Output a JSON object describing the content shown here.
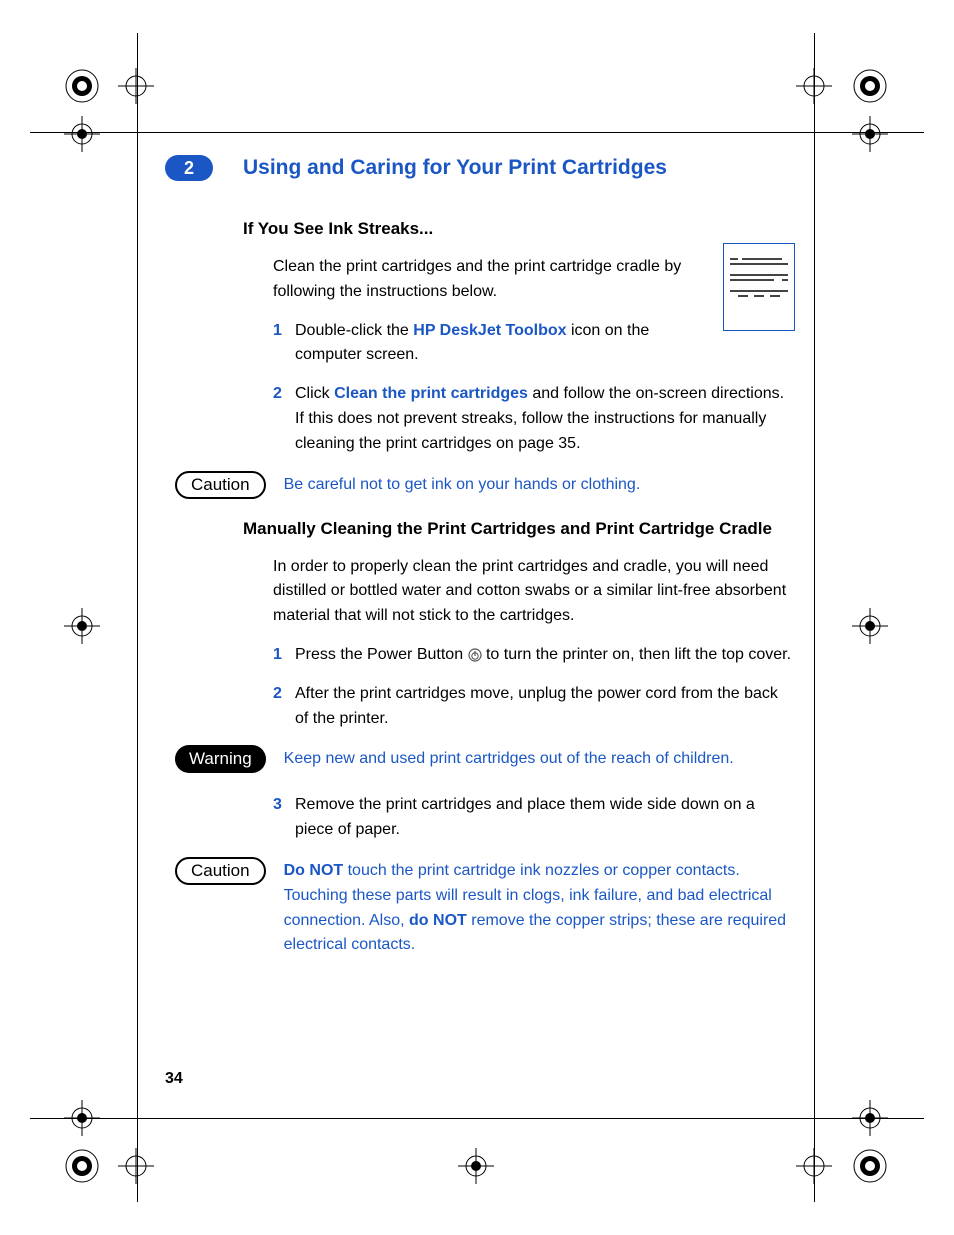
{
  "chapter": {
    "number": "2",
    "title": "Using and Caring for Your Print Cartridges"
  },
  "section1": {
    "title": "If You See Ink Streaks...",
    "intro": "Clean the print cartridges and the print cartridge cradle by following the instructions below.",
    "step1_a": "Double-click the ",
    "step1_link": "HP DeskJet Toolbox",
    "step1_b": " icon on the computer screen.",
    "step2_a": "Click ",
    "step2_link": "Clean the print cartridges",
    "step2_b": " and follow the on-screen directions. If this does not prevent streaks, follow the instructions for manually cleaning the print cartridges on page 35."
  },
  "caution1": {
    "label": "Caution",
    "text": "Be careful not to get ink on your hands or clothing."
  },
  "section2": {
    "title": "Manually Cleaning the Print Cartridges and Print Cartridge Cradle",
    "intro": "In order to properly clean the print cartridges and cradle, you will need distilled or bottled water and cotton swabs or a similar lint-free absorbent material that will not stick to the cartridges.",
    "step1_a": "Press the Power Button ",
    "step1_b": " to turn the printer on, then lift the top cover.",
    "step2": "After the print cartridges move, unplug the power cord from the back of the printer."
  },
  "warning": {
    "label": "Warning",
    "text": "Keep new and used print cartridges out of the reach of children."
  },
  "section2b": {
    "step3": "Remove the print cartridges and place them wide side down on a piece of paper."
  },
  "caution2": {
    "label": "Caution",
    "a": "Do NOT",
    "b": " touch the print cartridge ink nozzles or copper contacts. Touching these parts will result in clogs, ink failure, and bad electrical connection. Also, ",
    "c": "do NOT",
    "d": " remove the copper strips; these are required electrical contacts."
  },
  "pageNumber": "34",
  "nums": {
    "n1": "1",
    "n2": "2",
    "n3": "3"
  }
}
